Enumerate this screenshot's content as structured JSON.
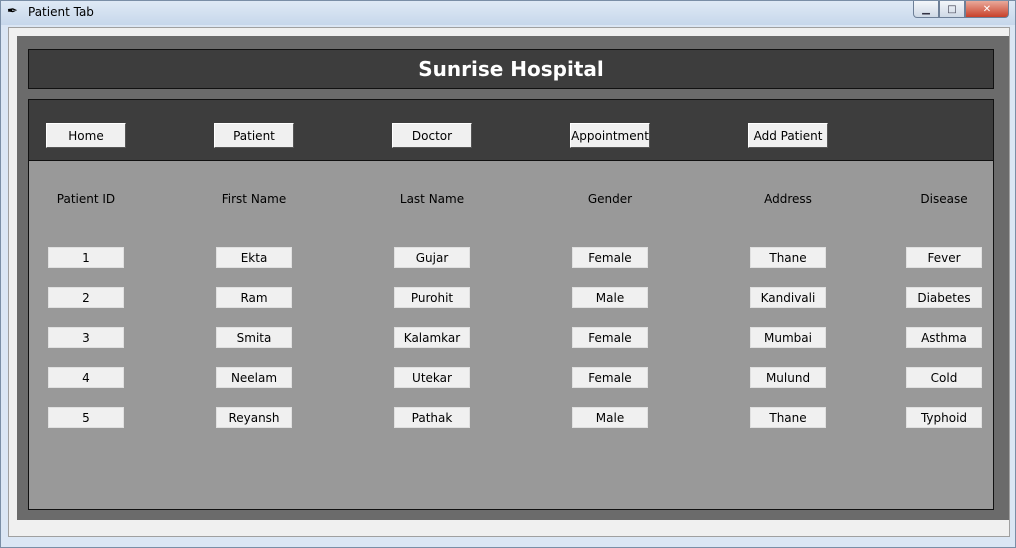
{
  "window": {
    "title": "Patient  Tab"
  },
  "header": {
    "title": "Sunrise Hospital"
  },
  "nav": {
    "home": "Home",
    "patient": "Patient",
    "doctor": "Doctor",
    "appointment": "Appointment",
    "add_patient": "Add Patient"
  },
  "table": {
    "columns": [
      "Patient ID",
      "First Name",
      "Last Name",
      "Gender",
      "Address",
      "Disease"
    ],
    "rows": [
      [
        "1",
        "Ekta",
        "Gujar",
        "Female",
        "Thane",
        "Fever"
      ],
      [
        "2",
        "Ram",
        "Purohit",
        "Male",
        "Kandivali",
        "Diabetes"
      ],
      [
        "3",
        "Smita",
        "Kalamkar",
        "Female",
        "Mumbai",
        "Asthma"
      ],
      [
        "4",
        "Neelam",
        "Utekar",
        "Female",
        "Mulund",
        "Cold"
      ],
      [
        "5",
        "Reyansh",
        "Pathak",
        "Male",
        "Thane",
        "Typhoid"
      ]
    ]
  },
  "colors": {
    "header_bg": "#3d3d3d",
    "panel_bg": "#999999",
    "outer_bg": "#6b6b6b"
  },
  "icons": {
    "app": "feather-icon",
    "minimize": "minimize-icon",
    "maximize": "maximize-icon",
    "close": "close-icon"
  }
}
